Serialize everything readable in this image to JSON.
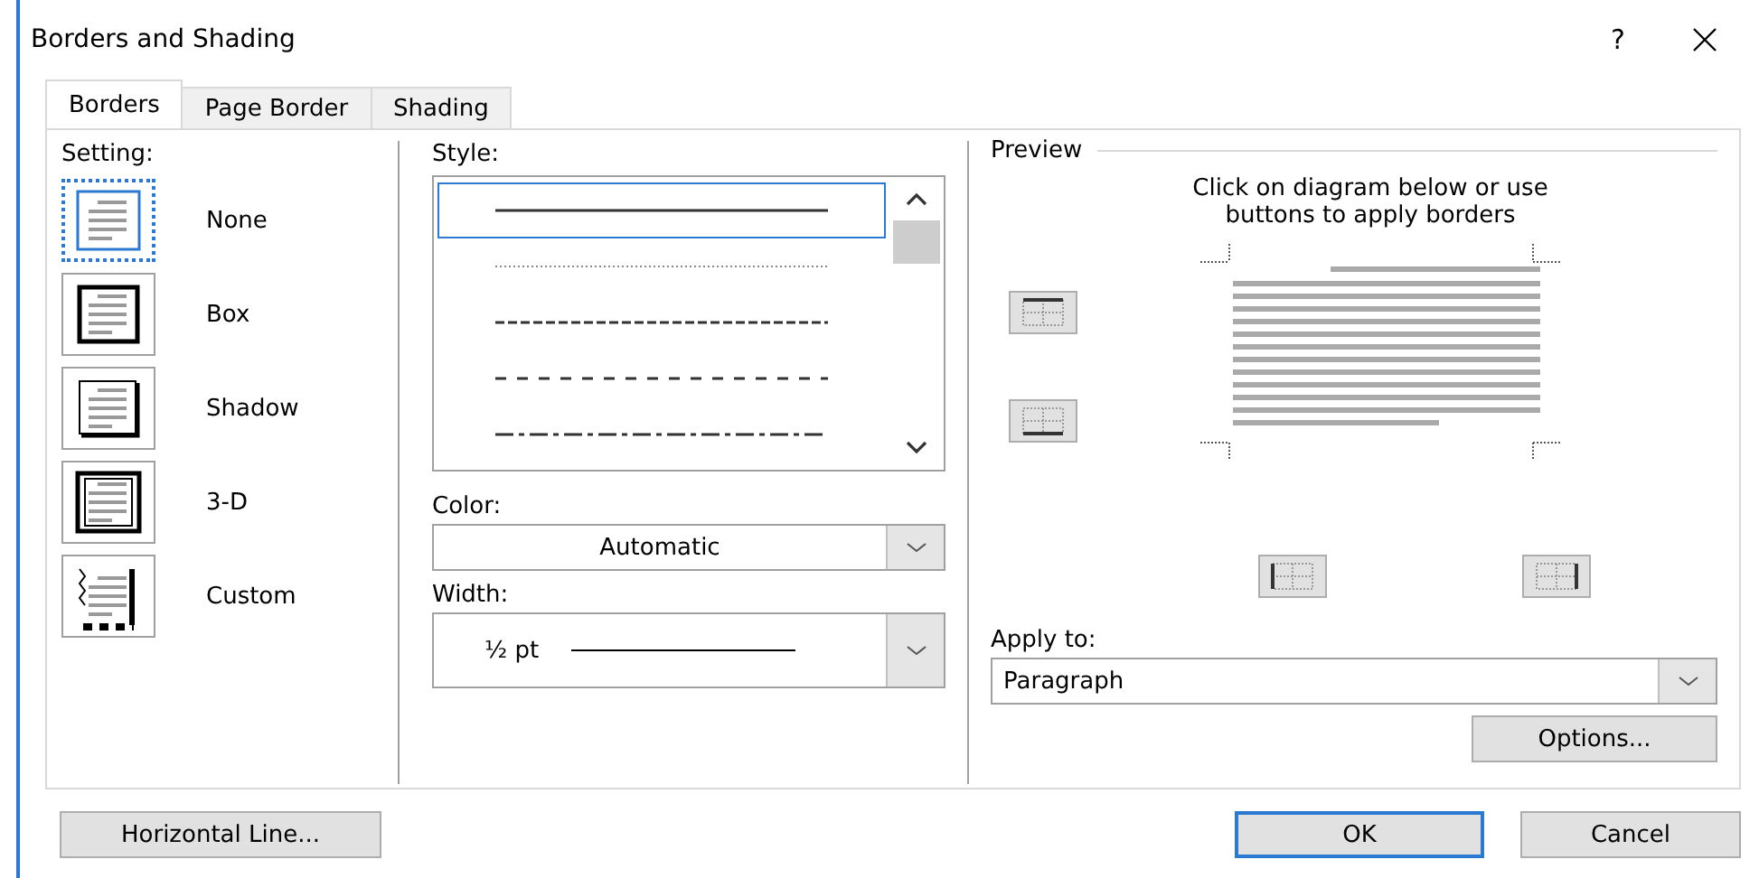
{
  "window": {
    "title": "Borders and Shading",
    "help": "?"
  },
  "tabs": [
    {
      "label": "Borders",
      "selected": true
    },
    {
      "label": "Page Border",
      "selected": false
    },
    {
      "label": "Shading",
      "selected": false
    }
  ],
  "setting": {
    "label": "Setting:",
    "options": [
      {
        "label": "None",
        "kind": "none",
        "selected": true
      },
      {
        "label": "Box",
        "kind": "box",
        "selected": false
      },
      {
        "label": "Shadow",
        "kind": "shadow",
        "selected": false
      },
      {
        "label": "3-D",
        "kind": "threed",
        "selected": false
      },
      {
        "label": "Custom",
        "kind": "custom",
        "selected": false
      }
    ]
  },
  "style": {
    "label": "Style:",
    "items": [
      {
        "kind": "solid",
        "selected": true
      },
      {
        "kind": "dotted",
        "selected": false
      },
      {
        "kind": "dashed",
        "selected": false
      },
      {
        "kind": "sparse-dash",
        "selected": false
      },
      {
        "kind": "dash-dot",
        "selected": false
      }
    ]
  },
  "color": {
    "label": "Color:",
    "value": "Automatic"
  },
  "width": {
    "label": "Width:",
    "value": "½ pt"
  },
  "preview": {
    "label": "Preview",
    "hint": "Click on diagram below or use buttons to apply borders"
  },
  "apply_to": {
    "label": "Apply to:",
    "value": "Paragraph"
  },
  "options_button": "Options...",
  "footer": {
    "left_button": "Horizontal Line...",
    "ok": "OK",
    "cancel": "Cancel"
  }
}
